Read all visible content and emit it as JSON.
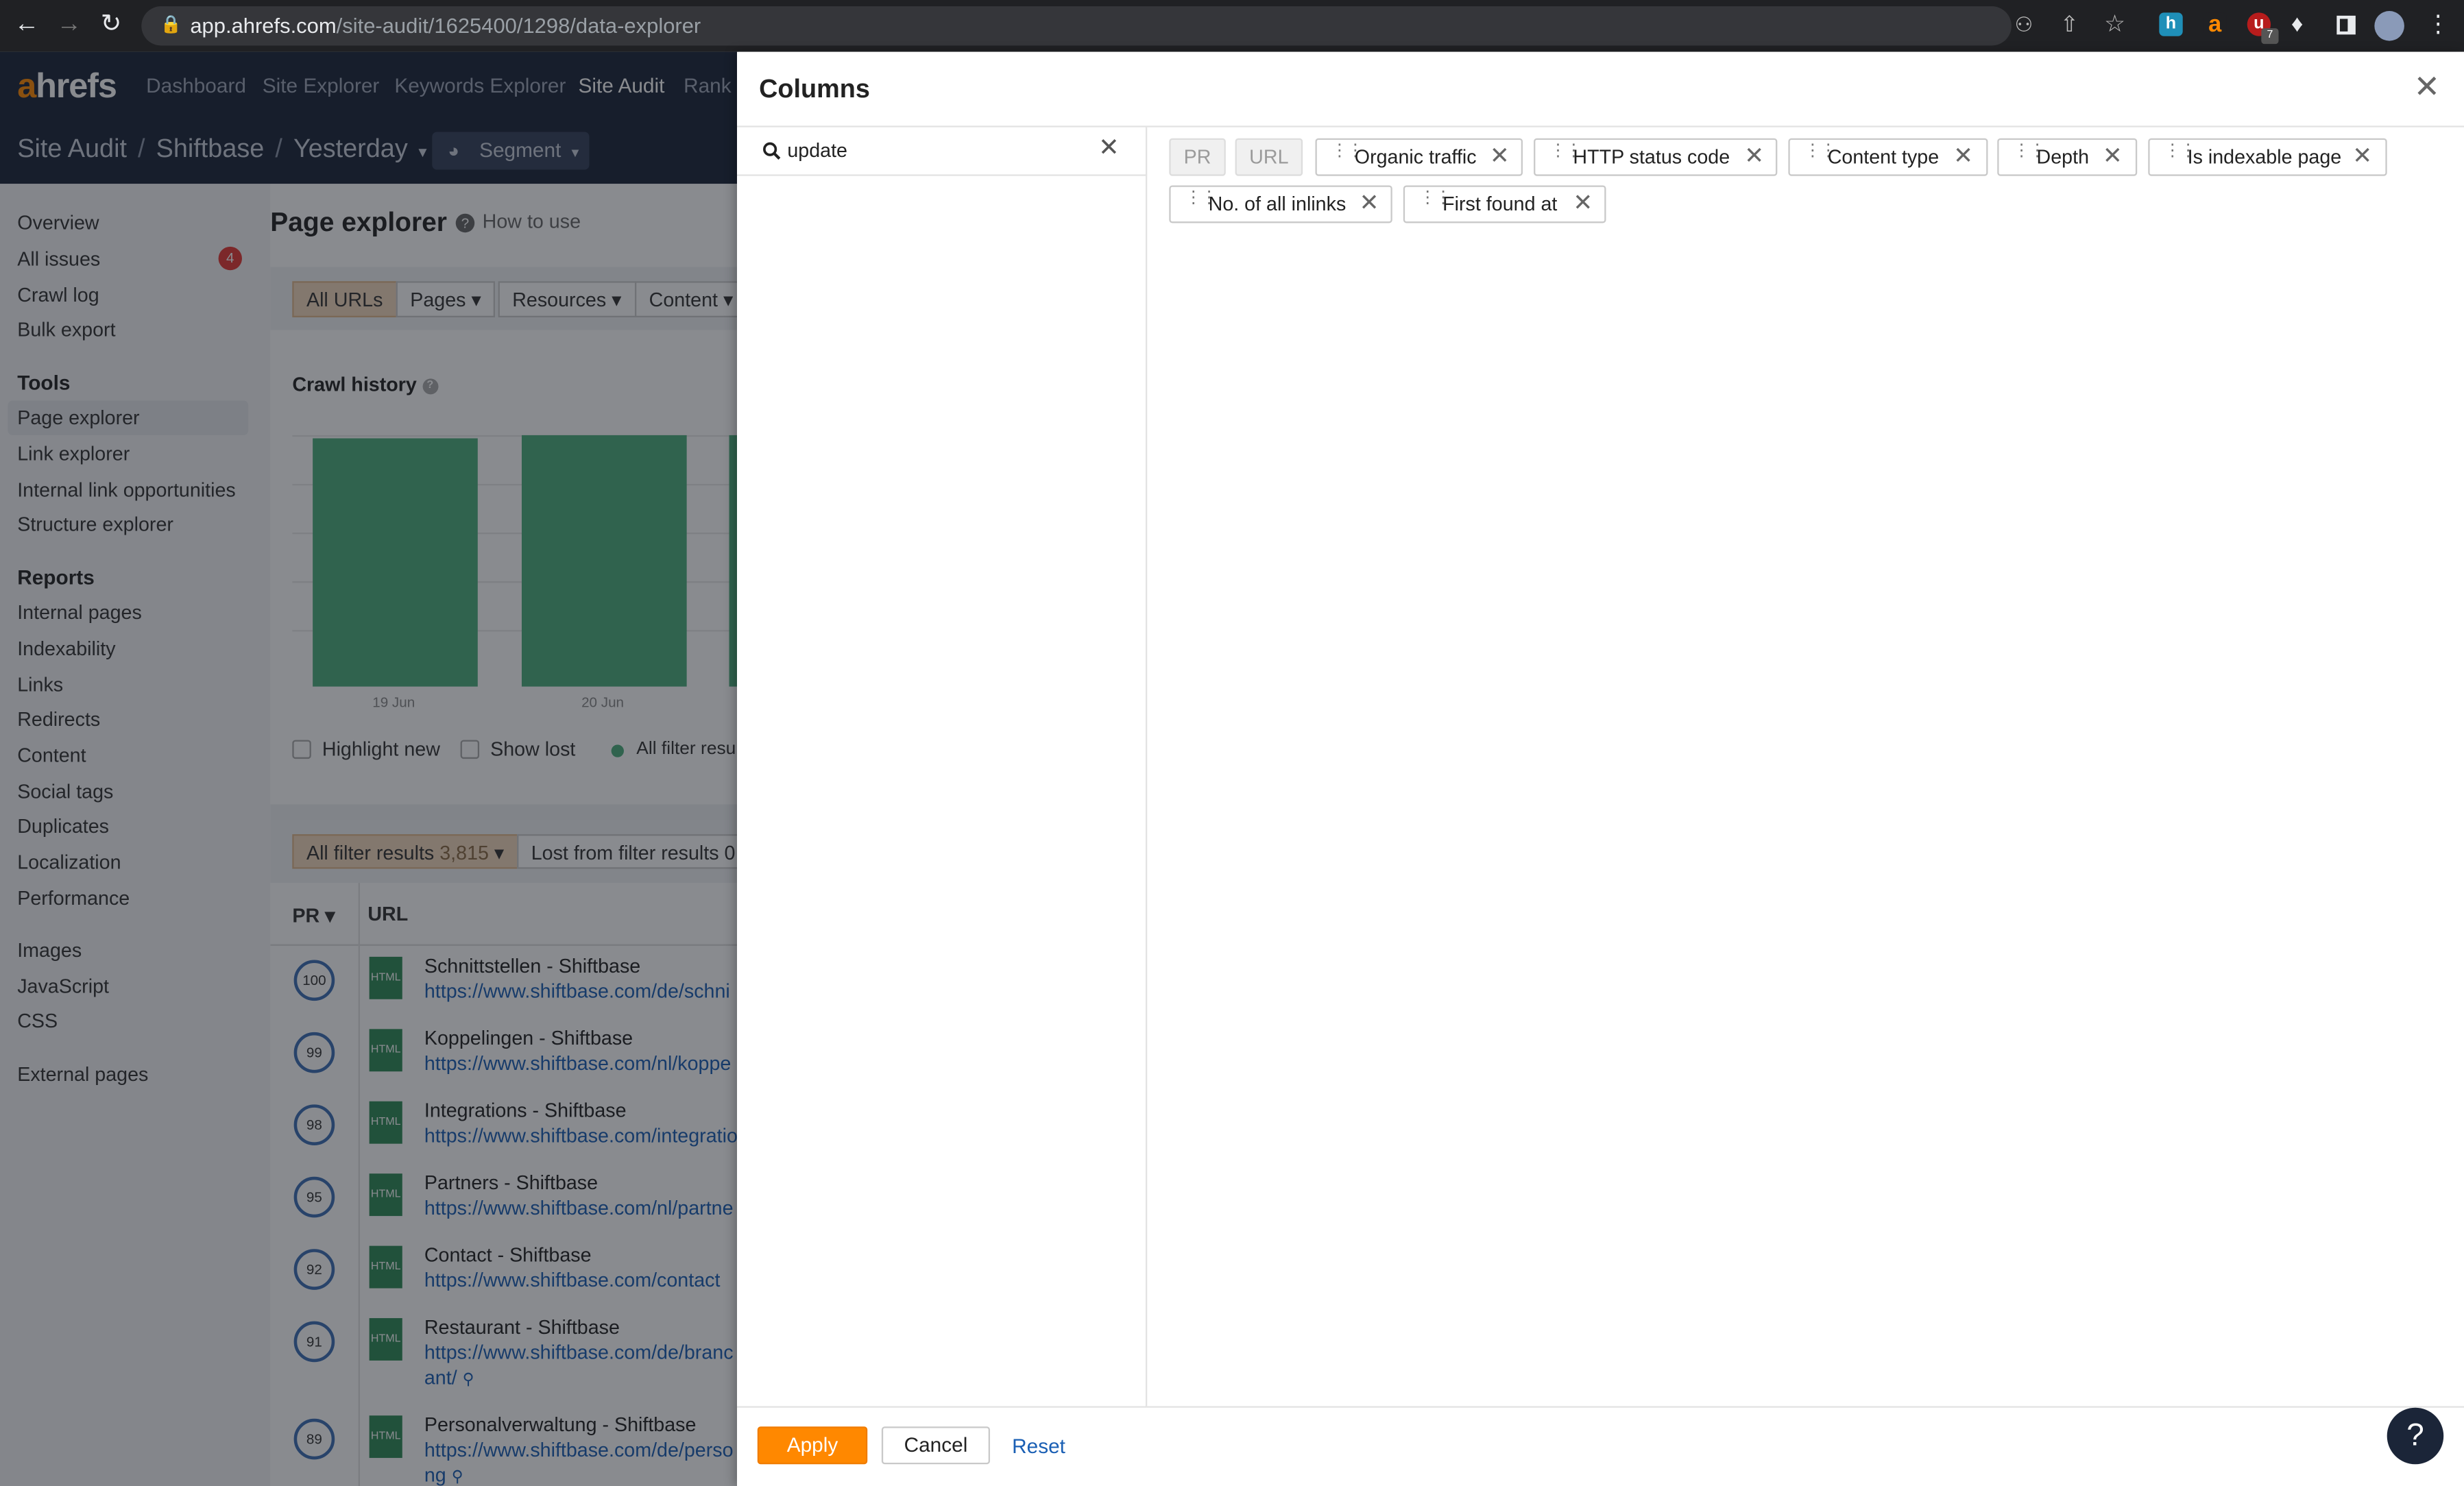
{
  "browser": {
    "url_domain": "app.ahrefs.com",
    "url_path": "/site-audit/1625400/1298/data-explorer",
    "ext_badge": "7"
  },
  "app": {
    "logo_a": "a",
    "logo_rest": "hrefs",
    "nav": [
      "Dashboard",
      "Site Explorer",
      "Keywords Explorer",
      "Site Audit",
      "Rank T"
    ],
    "breadcrumb": [
      "Site Audit",
      "Shiftbase",
      "Yesterday"
    ],
    "segment_label": "Segment"
  },
  "sidebar": {
    "top": [
      "Overview",
      "All issues",
      "Crawl log",
      "Bulk export"
    ],
    "issues_badge": "4",
    "tools_heading": "Tools",
    "tools": [
      "Page explorer",
      "Link explorer",
      "Internal link opportunities",
      "Structure explorer"
    ],
    "reports_heading": "Reports",
    "reports": [
      "Internal pages",
      "Indexability",
      "Links",
      "Redirects",
      "Content",
      "Social tags",
      "Duplicates",
      "Localization",
      "Performance"
    ],
    "resources": [
      "Images",
      "JavaScript",
      "CSS"
    ],
    "external": "External pages"
  },
  "main": {
    "title": "Page explorer",
    "how_to": "How to use",
    "tabs": [
      "All URLs",
      "Pages",
      "Resources",
      "Content"
    ],
    "crawl_history": "Crawl history",
    "x_labels": [
      "19 Jun",
      "20 Jun"
    ],
    "highlight_new": "Highlight new",
    "show_lost": "Show lost",
    "all_filter": "All filter resul",
    "filter_tab": "All filter results",
    "filter_count": "3,815",
    "lost_tab": "Lost from filter results 0",
    "col_pr": "PR",
    "col_url": "URL",
    "rows": [
      {
        "pr": "100",
        "title": "Schnittstellen - Shiftbase",
        "url": "https://www.shiftbase.com/de/schni"
      },
      {
        "pr": "99",
        "title": "Koppelingen - Shiftbase",
        "url": "https://www.shiftbase.com/nl/koppe"
      },
      {
        "pr": "98",
        "title": "Integrations - Shiftbase",
        "url": "https://www.shiftbase.com/integratio"
      },
      {
        "pr": "95",
        "title": "Partners - Shiftbase",
        "url": "https://www.shiftbase.com/nl/partne"
      },
      {
        "pr": "92",
        "title": "Contact - Shiftbase",
        "url": "https://www.shiftbase.com/contact"
      },
      {
        "pr": "91",
        "title": "Restaurant - Shiftbase",
        "url": "https://www.shiftbase.com/de/branc",
        "url2": "ant/"
      },
      {
        "pr": "89",
        "title": "Personalverwaltung - Shiftbase",
        "url": "https://www.shiftbase.com/de/perso",
        "url2": "ng"
      }
    ],
    "html_label": "HTML"
  },
  "modal": {
    "title": "Columns",
    "search_value": "update",
    "fixed_columns": [
      "PR",
      "URL"
    ],
    "columns": [
      "Organic traffic",
      "HTTP status code",
      "Content type",
      "Depth",
      "Is indexable page",
      "No. of all inlinks",
      "First found at"
    ],
    "apply": "Apply",
    "cancel": "Cancel",
    "reset": "Reset",
    "help": "?"
  },
  "colors": {
    "accent": "#ff8800",
    "link": "#1a5fb4",
    "chart_bar": "#4caf7d",
    "header_bg": "#1b2538"
  }
}
